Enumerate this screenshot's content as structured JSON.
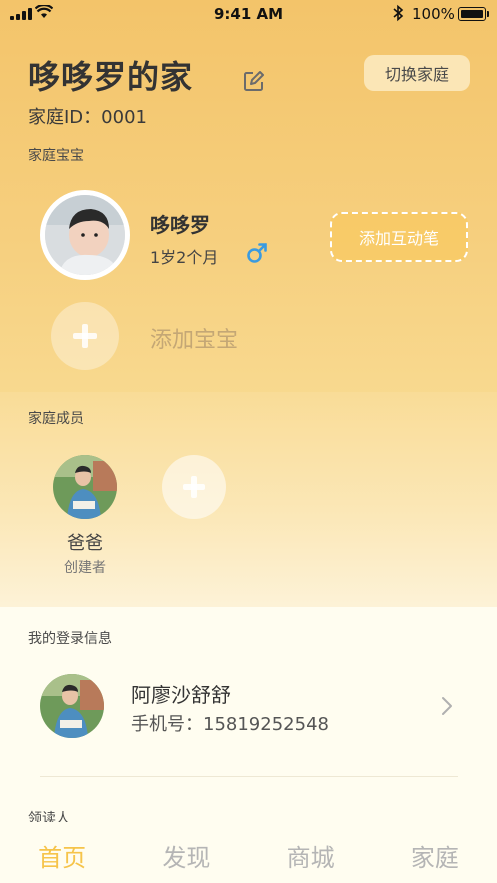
{
  "status_bar": {
    "time": "9:41 AM",
    "battery": "100%"
  },
  "header": {
    "family_name": "哆哆罗的家",
    "switch_label": "切换家庭",
    "family_id": "家庭ID：0001"
  },
  "babies_section": {
    "label": "家庭宝宝",
    "baby": {
      "name": "哆哆罗",
      "age": "1岁2个月",
      "gender_icon": "male-icon"
    },
    "add_pen_label": "添加互动笔",
    "add_baby_label": "添加宝宝"
  },
  "members_section": {
    "label": "家庭成员",
    "members": [
      {
        "name": "爸爸",
        "role": "创建者"
      }
    ]
  },
  "login_section": {
    "label": "我的登录信息",
    "name": "阿廖沙舒舒",
    "phone": "手机号：15819252548"
  },
  "reader_section": {
    "label": "领读人"
  },
  "tabbar": {
    "tabs": [
      {
        "label": "首页"
      },
      {
        "label": "发现"
      },
      {
        "label": "商城"
      },
      {
        "label": "家庭"
      }
    ]
  },
  "colors": {
    "accent": "#f6c44a",
    "male": "#3a9be0",
    "header_gradient_top": "#f3c46a"
  }
}
